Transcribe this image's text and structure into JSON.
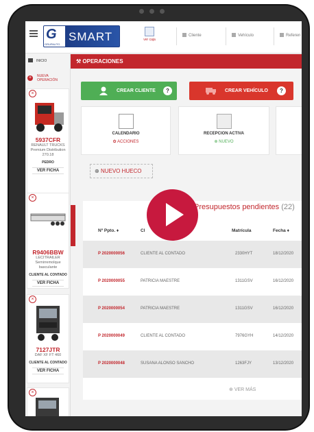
{
  "topbar": {
    "logo_text": "SMART",
    "logo_sub": "GRUPAUTO",
    "ver_caja": "ver caja",
    "cliente_placeholder": "Cliente",
    "vehiculo_placeholder": "Vehículo",
    "referencia_placeholder": "Referen"
  },
  "sidebar": {
    "inicio": "INICIO",
    "nueva_operacion": "NUEVA OPERACIÓN",
    "vehicles": [
      {
        "plate": "5937CFR",
        "desc": "RENAULT TRUCKS Premium Distribution 270.18",
        "owner": "PEDRO",
        "ver_ficha": "VER FICHA"
      },
      {
        "plate": "R9406BBW",
        "desc": "LECITRAILER Semirremolque basculante",
        "owner": "CLIENTE AL CONTADO",
        "ver_ficha": "VER FICHA"
      },
      {
        "plate": "7127JTR",
        "desc": "DAF XF FT 460",
        "owner": "CLIENTE AL CONTADO",
        "ver_ficha": "VER FICHA"
      }
    ]
  },
  "main": {
    "section_title": "OPERACIONES",
    "crear_cliente": "CREAR CLIENTE",
    "crear_vehiculo": "CREAR VEHÍCULO",
    "tiles": [
      {
        "title": "CALENDARIO",
        "action": "ACCIONES"
      },
      {
        "title": "RECEPCION ACTIVA",
        "action": "NUEVO"
      }
    ],
    "nuevo_hueco": "NUEVO HUECO"
  },
  "table": {
    "title": "Presupuestos pendientes",
    "count": "(22)",
    "headers": [
      "Nº Ppto.",
      "Cl",
      "Matrícula",
      "Fecha"
    ],
    "rows": [
      [
        "P 2020000056",
        "CLIENTE AL CONTADO",
        "2330HYT",
        "18/12/2020"
      ],
      [
        "P 2020000055",
        "PATRICIA MAESTRE",
        "1311GSV",
        "16/12/2020"
      ],
      [
        "P 2020000054",
        "PATRICIA MAESTRE",
        "1311GSV",
        "16/12/2020"
      ],
      [
        "P 2020000049",
        "CLIENTE AL CONTADO",
        "7976GYH",
        "14/12/2020"
      ],
      [
        "P 2020000048",
        "SUSANA ALONSO SANCHO",
        "1263FJY",
        "13/12/2020"
      ]
    ],
    "ver_mas": "VER MÁS"
  },
  "colors": {
    "brand_red": "#c2272d",
    "green": "#4fae55",
    "logo_blue": "#1d3d86",
    "play": "#c7193e"
  }
}
